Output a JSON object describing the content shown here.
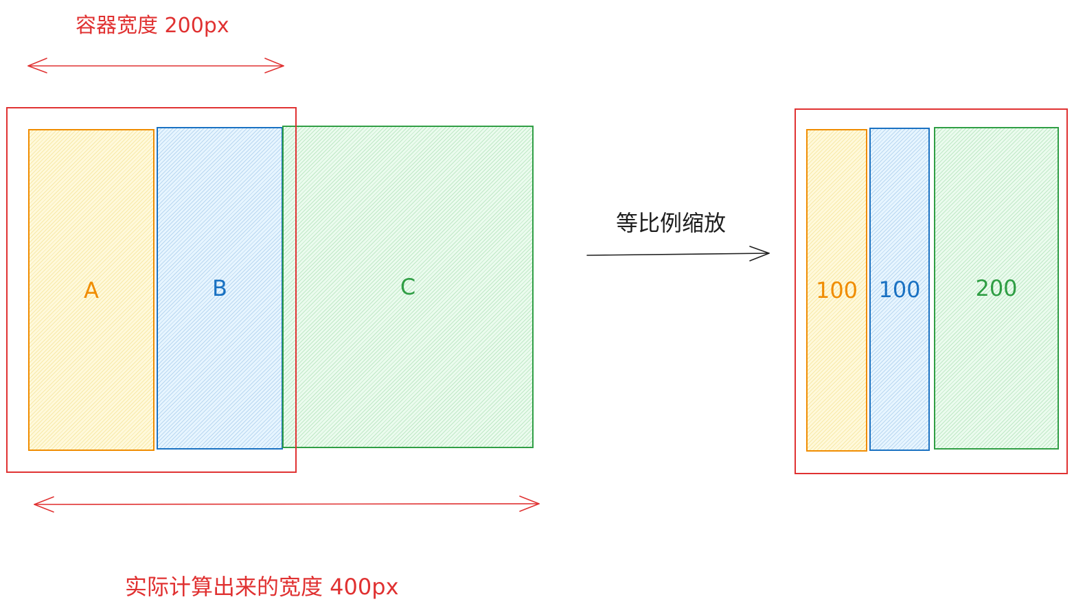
{
  "left_diagram": {
    "container_width_label": "容器宽度 200px",
    "actual_width_label": "实际计算出来的宽度 400px",
    "items": [
      {
        "label": "A",
        "color": "#f08c00"
      },
      {
        "label": "B",
        "color": "#1971c2"
      },
      {
        "label": "C",
        "color": "#2f9e44"
      }
    ]
  },
  "transform_label": "等比例缩放",
  "right_diagram": {
    "items": [
      {
        "label": "100",
        "color": "#f08c00"
      },
      {
        "label": "100",
        "color": "#1971c2"
      },
      {
        "label": "200",
        "color": "#2f9e44"
      }
    ]
  },
  "colors": {
    "container": "#e03131",
    "arrow": "#1e1e1e"
  }
}
